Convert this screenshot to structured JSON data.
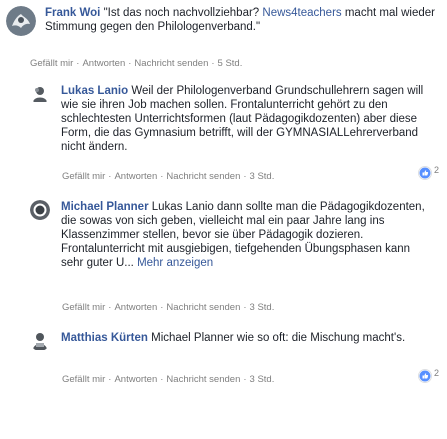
{
  "comments": [
    {
      "author": "Frank Woi",
      "text_before_link": "\"Ist das noch nachvollziehbar? ",
      "link": "News4teachers",
      "text_after_link": " macht mal wieder Stimmung gegen den Philologenverband.\"",
      "actions": {
        "like": "Gefällt mir",
        "reply": "Antworten",
        "message": "Nachricht senden",
        "time": "5 Std."
      }
    },
    {
      "author": "Lukas Lanio",
      "text": "Weil der Philologenverband Grundschullehrern sagen will wie sie ihren Job machen sollen. Frontalunterricht gehört zu den schlechtesten Unterrichtsformen (laut Pädagogikdozenten) aber diese Form, die das Gymnasium betrifft, will der GYMNASIALLehrerverband nicht ändern.",
      "actions": {
        "like": "Gefällt mir",
        "reply": "Antworten",
        "message": "Nachricht senden",
        "time": "3 Std."
      },
      "reactions": "2"
    },
    {
      "author": "Michael Planner",
      "text": "Lukas Lanio dann sollte man die Pädagogikdozenten, die sowas von sich geben, vielleicht mal ein paar Jahre lang ins Klassenzimmer stellen, bevor sie über Pädagogik dozieren. Frontalunterricht mit ausgiebigen, tiefgehenden Übungsphasen kann sehr guter U... ",
      "more": "Mehr anzeigen",
      "actions": {
        "like": "Gefällt mir",
        "reply": "Antworten",
        "message": "Nachricht senden",
        "time": "3 Std."
      }
    },
    {
      "author": "Matthias Kürten",
      "text": "Michael Planner wie so oft: die Mischung macht's.",
      "actions": {
        "like": "Gefällt mir",
        "reply": "Antworten",
        "message": "Nachricht senden",
        "time": "3 Std."
      },
      "reactions": "2"
    }
  ],
  "colors": {
    "link": "#365899",
    "text": "#1d2129",
    "meta": "#7f7f7f"
  }
}
